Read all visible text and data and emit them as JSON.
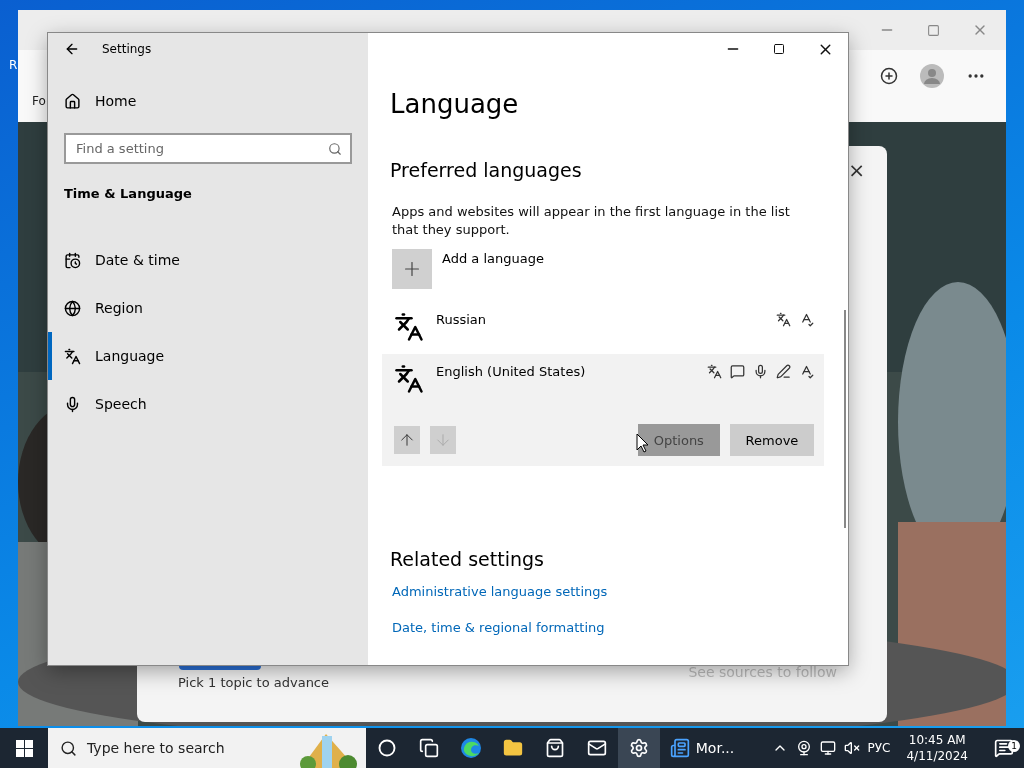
{
  "desktop": {
    "icon_label": "R"
  },
  "browser": {
    "toolbar_text": "Fo",
    "feed_card": {
      "close": "×",
      "topic_hint": "Pick 1 topic to advance",
      "sources_hint": "See sources to follow"
    }
  },
  "settings": {
    "title": "Settings",
    "home": "Home",
    "search_placeholder": "Find a setting",
    "section": "Time & Language",
    "nav": [
      {
        "label": "Date & time",
        "kind": "calendar",
        "selected": false
      },
      {
        "label": "Region",
        "kind": "globe",
        "selected": false
      },
      {
        "label": "Language",
        "kind": "language",
        "selected": true
      },
      {
        "label": "Speech",
        "kind": "mic",
        "selected": false
      }
    ]
  },
  "page": {
    "title": "Language",
    "section": "Preferred languages",
    "description": "Apps and websites will appear in the first language in the list that they support.",
    "add_label": "Add a language",
    "languages": [
      {
        "name": "Russian",
        "features": [
          {
            "kind": "display"
          },
          {
            "kind": "spelling"
          }
        ],
        "expanded": false
      },
      {
        "name": "English (United States)",
        "features": [
          {
            "kind": "display"
          },
          {
            "kind": "speech"
          },
          {
            "kind": "mic"
          },
          {
            "kind": "handwriting"
          },
          {
            "kind": "spelling"
          }
        ],
        "expanded": true,
        "move_up_disabled": false,
        "move_down_disabled": true,
        "buttons": [
          {
            "label": "Options",
            "pressed": true
          },
          {
            "label": "Remove",
            "pressed": false
          }
        ]
      }
    ],
    "related_title": "Related settings",
    "links": [
      "Administrative language settings",
      "Date, time & regional formatting"
    ]
  },
  "taskbar": {
    "search_placeholder": "Type here to search",
    "apps": [
      {
        "kind": "cortana",
        "active": false
      },
      {
        "kind": "taskview",
        "active": false
      },
      {
        "kind": "edge",
        "active": false
      },
      {
        "kind": "folder",
        "active": false
      },
      {
        "kind": "store",
        "active": false
      },
      {
        "kind": "mail",
        "active": false
      },
      {
        "kind": "settings",
        "active": true
      },
      {
        "kind": "widgets",
        "active": false,
        "label": "Mor..."
      }
    ],
    "language": "РУС",
    "time": "10:45 AM",
    "date": "4/11/2024",
    "notification_count": "1"
  }
}
